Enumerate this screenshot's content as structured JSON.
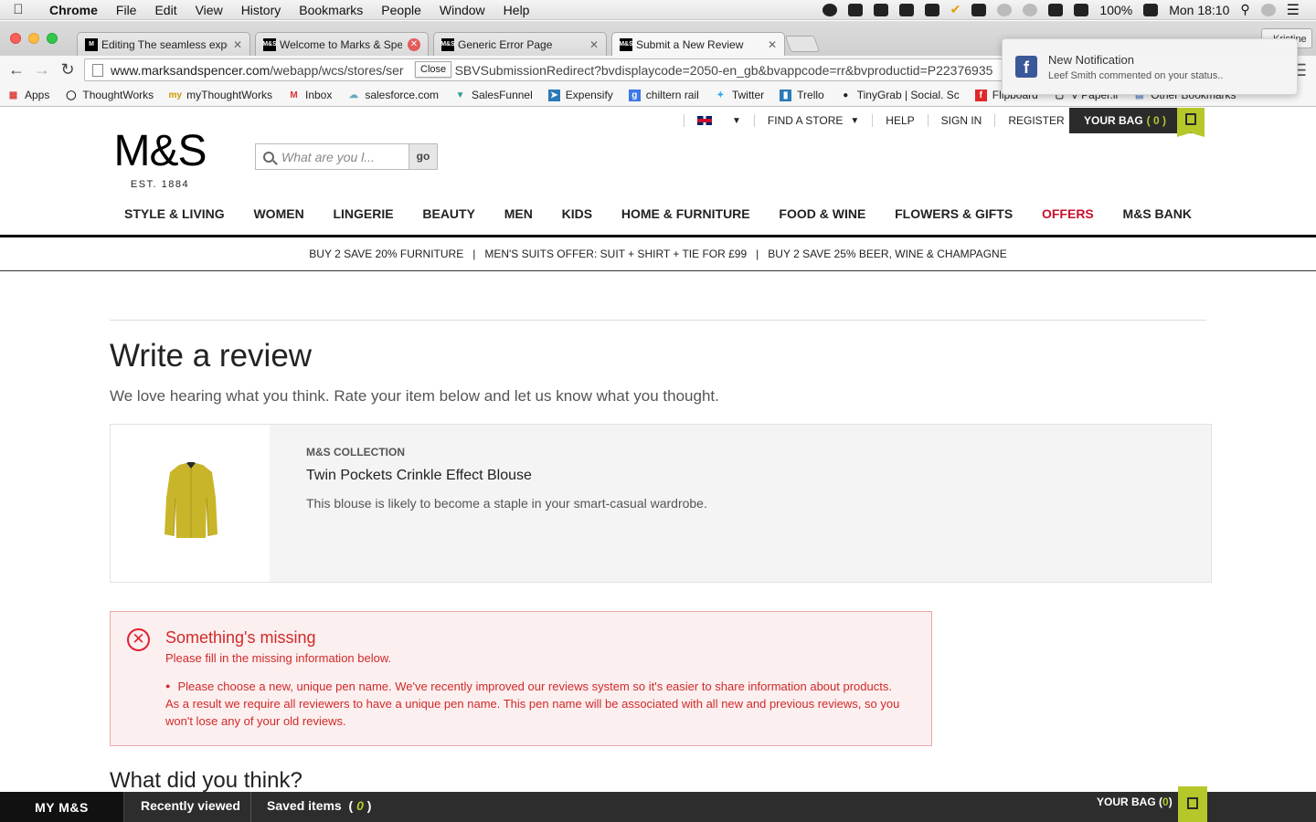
{
  "menubar": {
    "app": "Chrome",
    "items": [
      "File",
      "Edit",
      "View",
      "History",
      "Bookmarks",
      "People",
      "Window",
      "Help"
    ],
    "battery": "100%",
    "clock": "Mon 18:10"
  },
  "browser": {
    "tabs": [
      {
        "title": "Editing The seamless expe",
        "favicon": "M"
      },
      {
        "title": "Welcome to Marks & Spen",
        "favicon": "M&S"
      },
      {
        "title": "Generic Error Page",
        "favicon": "M&S"
      },
      {
        "title": "Submit a New Review",
        "favicon": "M&S"
      }
    ],
    "profile": "Kristine",
    "url_host": "www.marksandspencer.com",
    "url_path": "/webapp/wcs/stores/ser",
    "url_rest": "SBVSubmissionRedirect?bvdisplaycode=2050-en_gb&bvappcode=rr&bvproductid=P22376935",
    "close_tooltip": "Close",
    "bookmarks": [
      "Apps",
      "ThoughtWorks",
      "myThoughtWorks",
      "Inbox",
      "salesforce.com",
      "SalesFunnel",
      "Expensify",
      "chiltern rail",
      "Twitter",
      "Trello",
      "TinyGrab | Social. Sc",
      "Flipboard",
      "V Paper.li",
      "Other Bookmarks"
    ]
  },
  "notification": {
    "title": "New Notification",
    "body": "Leef Smith commented on your status.."
  },
  "header": {
    "find_store": "FIND A STORE",
    "help": "HELP",
    "sign_in": "SIGN IN",
    "register": "REGISTER",
    "bag_label": "YOUR BAG",
    "bag_count": "( 0 )",
    "logo": "M&S",
    "est": "EST. 1884",
    "search_placeholder": "What are you l...",
    "search_go": "go"
  },
  "nav": [
    "STYLE & LIVING",
    "WOMEN",
    "LINGERIE",
    "BEAUTY",
    "MEN",
    "KIDS",
    "HOME & FURNITURE",
    "FOOD & WINE",
    "FLOWERS & GIFTS",
    "OFFERS",
    "M&S BANK"
  ],
  "promos": [
    "BUY 2 SAVE 20% FURNITURE",
    "MEN'S SUITS OFFER: SUIT + SHIRT + TIE FOR £99",
    "BUY 2 SAVE 25% BEER, WINE & CHAMPAGNE"
  ],
  "page": {
    "title": "Write a review",
    "intro": "We love hearing what you think. Rate your item below and let us know what you thought.",
    "product": {
      "brand": "M&S COLLECTION",
      "name": "Twin Pockets Crinkle Effect Blouse",
      "description": "This blouse is likely to become a staple in your smart-casual wardrobe."
    },
    "error": {
      "title": "Something's missing",
      "subtitle": "Please fill in the missing information below.",
      "message": "Please choose a new, unique pen name. We've recently improved our reviews system so it's easier to share information about products. As a result we require all reviewers to have a unique pen name. This pen name will be associated with all new and previous reviews, so you won't lose any of your old reviews."
    },
    "section_title": "What did you think?"
  },
  "footer": {
    "my_ms": "MY M&S",
    "recently_viewed": "Recently viewed",
    "saved_items": "Saved items",
    "saved_count": "0",
    "bag_label": "YOUR BAG",
    "bag_count": "0"
  },
  "colors": {
    "offers_red": "#c8102e",
    "brand_lime": "#b6c729",
    "error_red": "#d02a2a",
    "error_bg": "#fcefef"
  }
}
